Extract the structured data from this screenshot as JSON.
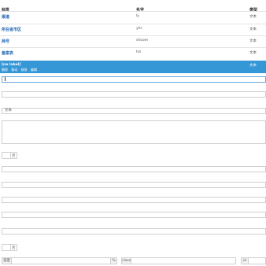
{
  "table": {
    "headers": {
      "label": "标签",
      "name": "名字",
      "type": "类型"
    },
    "rows": [
      {
        "label": "渠道",
        "name": "ly",
        "type": "文本"
      },
      {
        "label": "所在省市区",
        "name": "yhc",
        "type": "文本"
      },
      {
        "label": "商号",
        "name": "shoom",
        "type": "文本"
      },
      {
        "label": "备案表",
        "name": "hd",
        "type": "文本"
      }
    ],
    "selected": {
      "title": "[no label]",
      "actions": [
        "删除",
        "移动",
        "修改",
        "编辑"
      ],
      "type": "文本"
    }
  },
  "form": {
    "select_value": "文本",
    "toggle1_label": "否",
    "toggle2_label": "否",
    "bottom": {
      "prefix_label": "宽度",
      "suffix_label": "%",
      "class_label": "class",
      "id_label": "id"
    }
  }
}
